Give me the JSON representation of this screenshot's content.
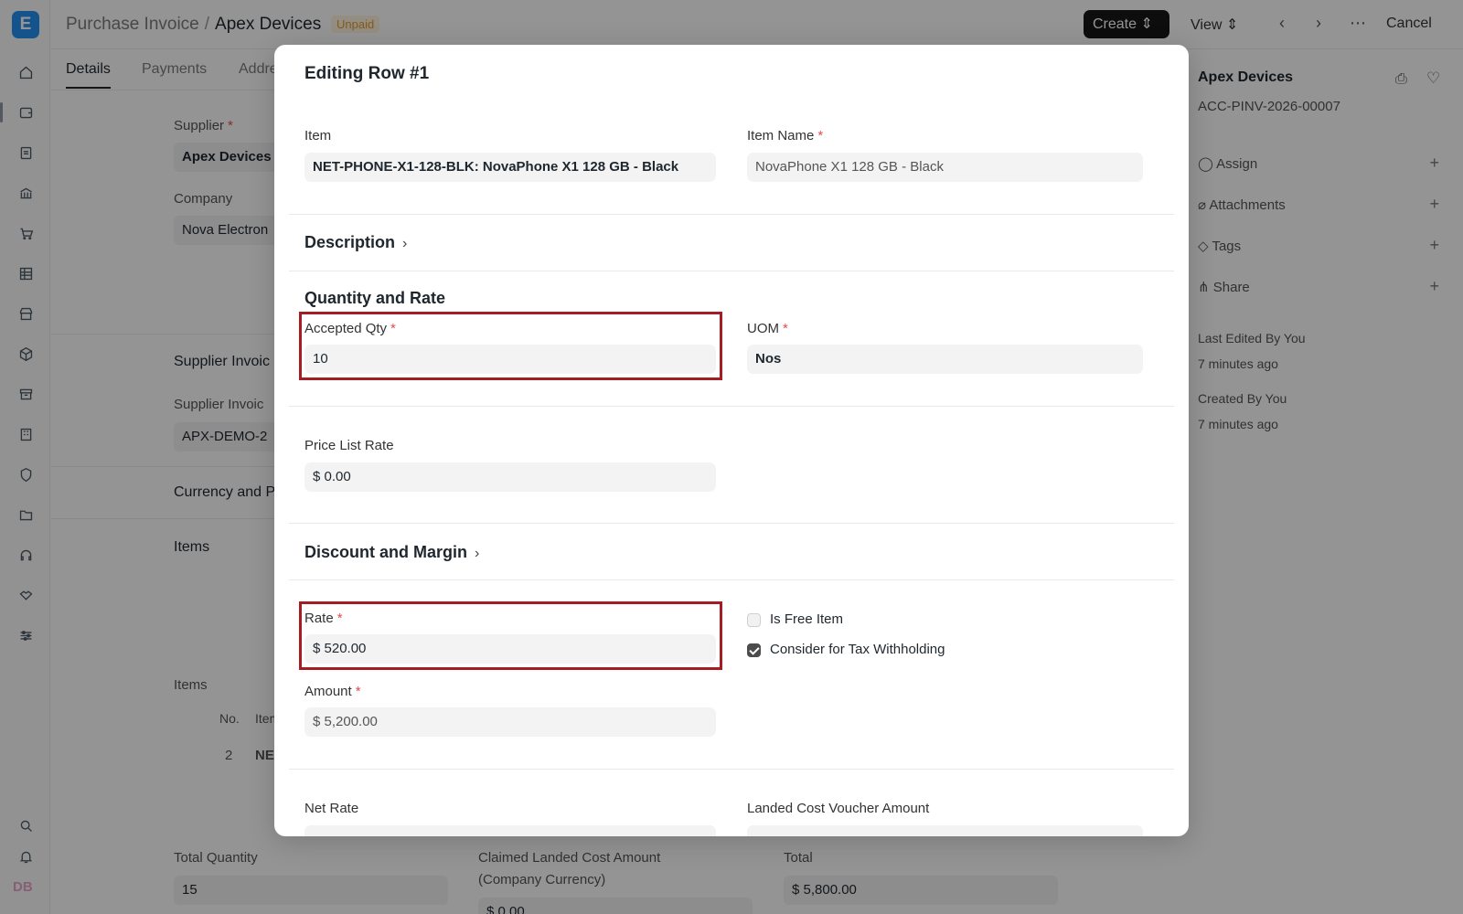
{
  "app": {
    "logo_letter": "E",
    "user_initials": "DB",
    "sidebar_icons": [
      "home-icon",
      "wallet-icon",
      "document-icon",
      "bank-icon",
      "cart-icon",
      "table-icon",
      "store-icon",
      "package-icon",
      "archive-icon",
      "building-icon",
      "shield-icon",
      "folder-icon",
      "headset-icon",
      "handshake-icon",
      "sliders-icon",
      "search-icon",
      "bell-icon"
    ]
  },
  "header": {
    "doctype": "Purchase Invoice",
    "separator": "/",
    "record": "Apex Devices",
    "status": "Unpaid",
    "create_label": "Create",
    "view_label": "View",
    "cancel_label": "Cancel"
  },
  "tabs": [
    "Details",
    "Payments",
    "Addre"
  ],
  "form_bg": {
    "supplier_label": "Supplier",
    "supplier_value": "Apex Devices",
    "company_label": "Company",
    "company_value": "Nova Electron",
    "supplier_invoice_section": "Supplier Invoic",
    "supplier_invoice_label": "Supplier Invoic",
    "supplier_invoice_value": "APX-DEMO-2",
    "currency_section": "Currency and P",
    "items_section": "Items",
    "items_label": "Items",
    "items_col_no": "No.",
    "items_col_item": "Item",
    "items_row_no": "2",
    "items_row_item": "NE",
    "total_qty_label": "Total Quantity",
    "total_qty_value": "15",
    "claimed_label_1": "Claimed Landed Cost Amount",
    "claimed_label_2": "(Company Currency)",
    "claimed_value": "$ 0.00",
    "total_label": "Total",
    "total_value": "$ 5,800.00"
  },
  "right_panel": {
    "title": "Apex Devices",
    "doc_id": "ACC-PINV-2026-00007",
    "assign": "Assign",
    "attachments": "Attachments",
    "tags": "Tags",
    "share": "Share",
    "last_edited": "Last Edited By You",
    "last_edited_time": "7 minutes ago",
    "created": "Created By You",
    "created_time": "7 minutes ago"
  },
  "modal": {
    "title": "Editing Row #1",
    "item_label": "Item",
    "item_value": "NET-PHONE-X1-128-BLK: NovaPhone X1 128 GB - Black",
    "item_name_label": "Item Name",
    "item_name_value": "NovaPhone X1 128 GB - Black",
    "description_section": "Description",
    "qty_rate_section": "Quantity and Rate",
    "accepted_qty_label": "Accepted Qty",
    "accepted_qty_value": "10",
    "uom_label": "UOM",
    "uom_value": "Nos",
    "price_list_rate_label": "Price List Rate",
    "price_list_rate_value": "$ 0.00",
    "discount_section": "Discount and Margin",
    "rate_label": "Rate",
    "rate_value": "$ 520.00",
    "is_free_item_label": "Is Free Item",
    "is_free_item_checked": false,
    "tax_withholding_label": "Consider for Tax Withholding",
    "tax_withholding_checked": true,
    "amount_label": "Amount",
    "amount_value": "$ 5,200.00",
    "net_rate_label": "Net Rate",
    "landed_cost_label": "Landed Cost Voucher Amount",
    "required_marker": "*",
    "chevron": "›",
    "highlight_color": "#a31d22"
  }
}
